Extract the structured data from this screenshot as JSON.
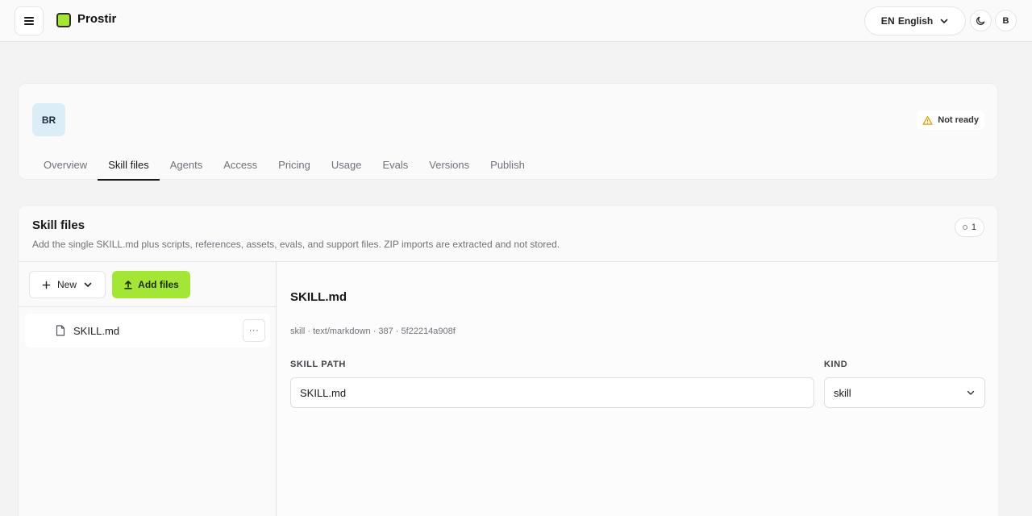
{
  "topbar": {
    "brand": "Prostir",
    "language": {
      "code": "EN",
      "label": "English"
    },
    "user_initial": "B"
  },
  "header": {
    "avatar_initials": "BR",
    "status": "Not ready",
    "status_color": "#e0a100",
    "tabs": [
      {
        "label": "Overview"
      },
      {
        "label": "Skill files",
        "active": true
      },
      {
        "label": "Agents"
      },
      {
        "label": "Access"
      },
      {
        "label": "Pricing"
      },
      {
        "label": "Usage"
      },
      {
        "label": "Evals"
      },
      {
        "label": "Versions"
      },
      {
        "label": "Publish"
      }
    ]
  },
  "files": {
    "title": "Skill files",
    "description": "Add the single SKILL.md plus scripts, references, assets, evals, and support files. ZIP imports are extracted and not stored.",
    "count": "1",
    "new_label": "New",
    "add_label": "Add files",
    "accent_color": "#a3e635",
    "items": [
      {
        "name": "SKILL.md",
        "more": "···"
      }
    ]
  },
  "editor": {
    "title": "SKILL.md",
    "meta": "skill · text/markdown · 387 · 5f22214a908f",
    "path_label": "SKILL PATH",
    "path_value": "SKILL.md",
    "kind_label": "KIND",
    "kind_value": "skill"
  }
}
